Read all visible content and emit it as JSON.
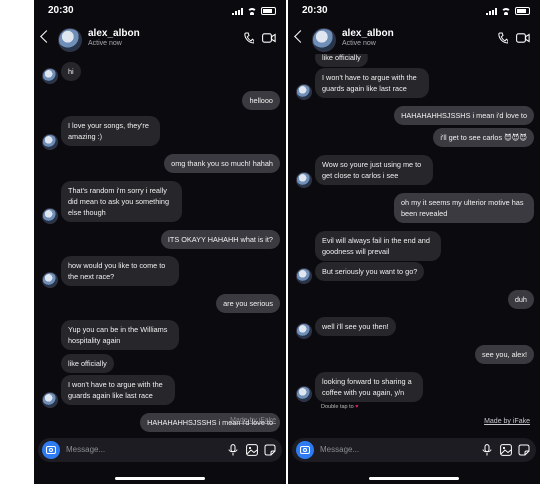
{
  "status_bar": {
    "time": "20:30"
  },
  "header": {
    "name": "alex_albon",
    "status": "Active now"
  },
  "composer": {
    "placeholder": "Message..."
  },
  "watermark": "Made by iFake",
  "liked_note": "Double tap to",
  "icons": {
    "back": "chevron-left-icon",
    "call": "phone-icon",
    "video": "video-camera-icon",
    "camera": "camera-icon",
    "mic": "microphone-icon",
    "gallery": "image-icon",
    "sticker": "sticker-icon"
  },
  "colors": {
    "background": "#0b0b0f",
    "incoming_bubble": "#26262b",
    "outgoing_bubble": "#3a3a40",
    "camera_button": "#2f7bf1",
    "heart": "#e0245e"
  },
  "left_screen": {
    "messages": [
      {
        "side": "in",
        "text": "hi"
      },
      {
        "side": "out",
        "text": "hellooo"
      },
      {
        "side": "in",
        "text": "I love your songs, they're amazing :)"
      },
      {
        "side": "out",
        "text": "omg thank you so much! hahah"
      },
      {
        "side": "in",
        "text": "That's random i'm sorry i really did mean to ask you something else though"
      },
      {
        "side": "out",
        "text": "ITS OKAYY HAHAHH what is it?"
      },
      {
        "side": "in",
        "text": "how would you like to come to the next race?"
      },
      {
        "side": "out",
        "text": "are you serious"
      },
      {
        "side": "in",
        "text": "Yup you can be in the Williams hospitality again"
      },
      {
        "side": "in",
        "text": "like officially"
      },
      {
        "side": "in",
        "text": "I won't have to argue with the guards again like last race"
      },
      {
        "side": "out",
        "text": "HAHAHAHHSJSSHS i mean i'd love to"
      }
    ]
  },
  "right_screen": {
    "messages": [
      {
        "side": "in",
        "text": "like officially"
      },
      {
        "side": "in",
        "text": "I won't have to argue with the guards again like last race"
      },
      {
        "side": "out",
        "text": "HAHAHAHHSJSSHS i mean i'd love to"
      },
      {
        "side": "out",
        "text": "i'll get to see carlos 😈😈😈"
      },
      {
        "side": "in",
        "text": "Wow so youre just using me to get close to carlos i see"
      },
      {
        "side": "out",
        "text": "oh my it seems my ulterior motive has been revealed"
      },
      {
        "side": "in",
        "text": "Evil will always fail in the end and goodness will prevail"
      },
      {
        "side": "in",
        "text": "But seriously you want to go?"
      },
      {
        "side": "out",
        "text": "duh"
      },
      {
        "side": "in",
        "text": "well i'll see you then!"
      },
      {
        "side": "out",
        "text": "see you, alex!"
      },
      {
        "side": "in",
        "text": "looking forward to sharing a coffee with you again, y/n"
      }
    ]
  }
}
